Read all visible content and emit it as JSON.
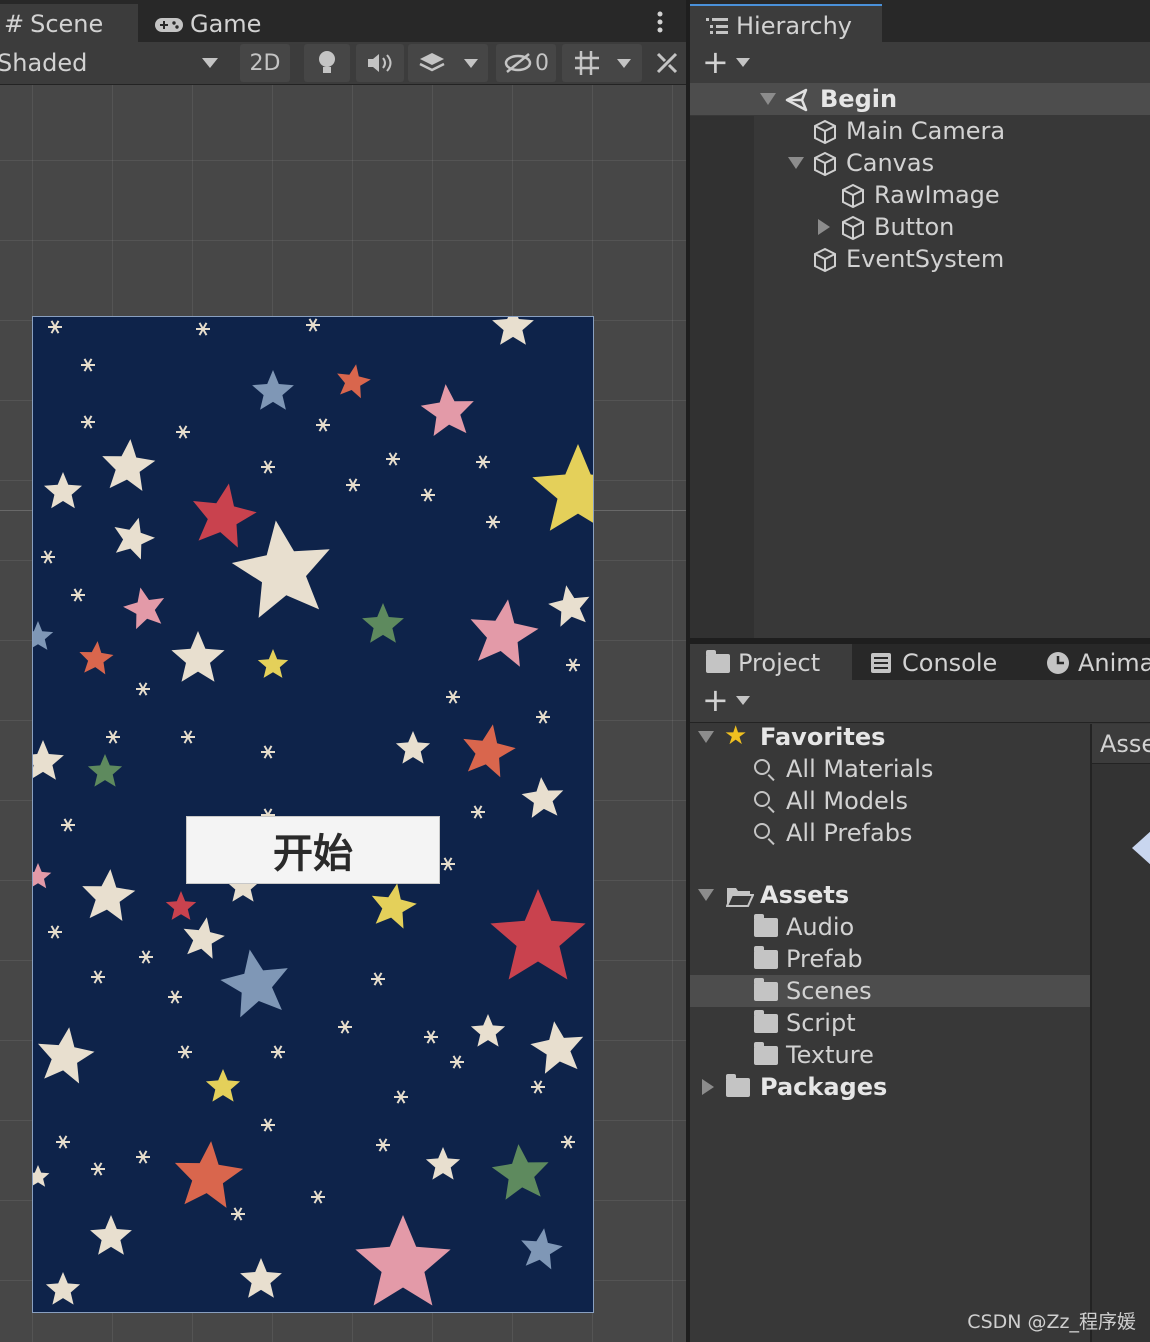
{
  "scene_panel": {
    "tabs": [
      {
        "label": "Scene",
        "icon": "grid-hash-icon"
      },
      {
        "label": "Game",
        "icon": "gamepad-icon"
      }
    ],
    "shading_mode": "Shaded",
    "toggle_2d": "2D",
    "gizmo_count": "0",
    "start_button_label": "开始"
  },
  "hierarchy": {
    "tab_label": "Hierarchy",
    "items": [
      {
        "label": "Begin",
        "icon": "unity-scene-icon"
      },
      {
        "label": "Main Camera",
        "icon": "gameobject-cube-icon"
      },
      {
        "label": "Canvas",
        "icon": "gameobject-cube-icon"
      },
      {
        "label": "RawImage",
        "icon": "gameobject-cube-icon"
      },
      {
        "label": "Button",
        "icon": "gameobject-cube-icon"
      },
      {
        "label": "EventSystem",
        "icon": "gameobject-cube-icon"
      }
    ]
  },
  "project_panel": {
    "tabs": [
      {
        "label": "Project",
        "icon": "folder-icon"
      },
      {
        "label": "Console",
        "icon": "console-icon"
      },
      {
        "label": "Anima",
        "icon": "clock-icon"
      }
    ],
    "favorites_label": "Favorites",
    "favorites": [
      "All Materials",
      "All Models",
      "All Prefabs"
    ],
    "assets_label": "Assets",
    "asset_folders": [
      "Audio",
      "Prefab",
      "Scenes",
      "Script",
      "Texture"
    ],
    "packages_label": "Packages",
    "breadcrumb": "Asse"
  },
  "watermark": "CSDN @Zz_程序媛",
  "colors": {
    "canvas_bg": "#0e234a",
    "editor_bg": "#383838",
    "selected_row": "#4d4d4d",
    "star_yellow": "#f0c020"
  }
}
